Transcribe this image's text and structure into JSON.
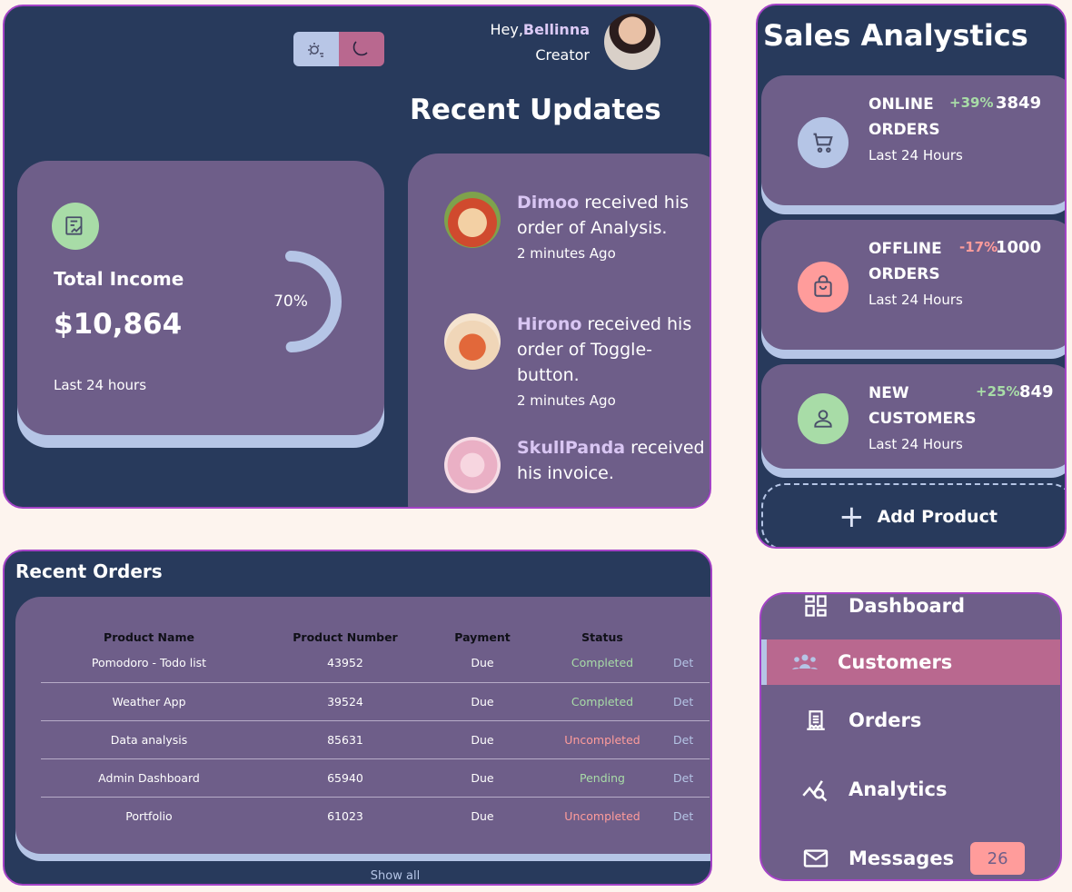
{
  "header": {
    "greeting": "Hey,",
    "user_name": "Bellinna",
    "user_role": "Creator",
    "theme_toggle": {
      "light_icon": "sun-icon",
      "dark_icon": "moon-icon",
      "active": "dark"
    }
  },
  "income": {
    "label": "Total Income",
    "amount": "$10,864",
    "percent_text": "70%",
    "percent_value": 0.7,
    "period": "Last 24 hours",
    "icon": "chart-icon"
  },
  "updates": {
    "title": "Recent Updates",
    "items": [
      {
        "name": "Dimoo",
        "message": " received his order of Analysis.",
        "time": "2 minutes Ago"
      },
      {
        "name": "Hirono",
        "message": " received his order of Toggle-button.",
        "time": "2 minutes Ago"
      },
      {
        "name": "SkullPanda",
        "message": " received his invoice.",
        "time": ""
      }
    ]
  },
  "sales": {
    "title": "Sales Analystics",
    "cards": [
      {
        "name": "ONLINE ORDERS",
        "period": "Last 24 Hours",
        "percent": "+39%",
        "value": "3849",
        "icon": "cart-icon"
      },
      {
        "name": "OFFLINE ORDERS",
        "period": "Last 24 Hours",
        "percent": "-17%",
        "value": "1000",
        "icon": "shopping-bag-icon"
      },
      {
        "name": "NEW CUSTOMERS",
        "period": "Last 24 Hours",
        "percent": "+25%",
        "value": "849",
        "icon": "person-icon"
      }
    ],
    "add_product_label": "Add Product"
  },
  "orders": {
    "title": "Recent Orders",
    "columns": [
      "Product Name",
      "Product Number",
      "Payment",
      "Status"
    ],
    "rows": [
      {
        "name": "Pomodoro - Todo list",
        "number": "43952",
        "payment": "Due",
        "status": "Completed",
        "details": "Det"
      },
      {
        "name": "Weather App",
        "number": "39524",
        "payment": "Due",
        "status": "Completed",
        "details": "Det"
      },
      {
        "name": "Data analysis",
        "number": "85631",
        "payment": "Due",
        "status": "Uncompleted",
        "details": "Det"
      },
      {
        "name": "Admin Dashboard",
        "number": "65940",
        "payment": "Due",
        "status": "Pending",
        "details": "Det"
      },
      {
        "name": "Portfolio",
        "number": "61023",
        "payment": "Due",
        "status": "Uncompleted",
        "details": "Det"
      }
    ],
    "show_all": "Show all"
  },
  "nav": {
    "items": [
      {
        "label": "Dashboard",
        "icon": "dashboard-icon"
      },
      {
        "label": "Customers",
        "icon": "customers-icon",
        "active": true
      },
      {
        "label": "Orders",
        "icon": "receipt-icon"
      },
      {
        "label": "Analytics",
        "icon": "analytics-icon"
      },
      {
        "label": "Messages",
        "icon": "mail-icon",
        "badge": "26"
      }
    ]
  },
  "colors": {
    "background": "#fdf4ee",
    "panel": "#283a5c",
    "card": "#6e5e89",
    "border": "#a443c6",
    "accent_blue": "#b5c5e6",
    "accent_pink": "#b9688f",
    "success": "#a8dca7",
    "danger": "#ff9c9b"
  }
}
